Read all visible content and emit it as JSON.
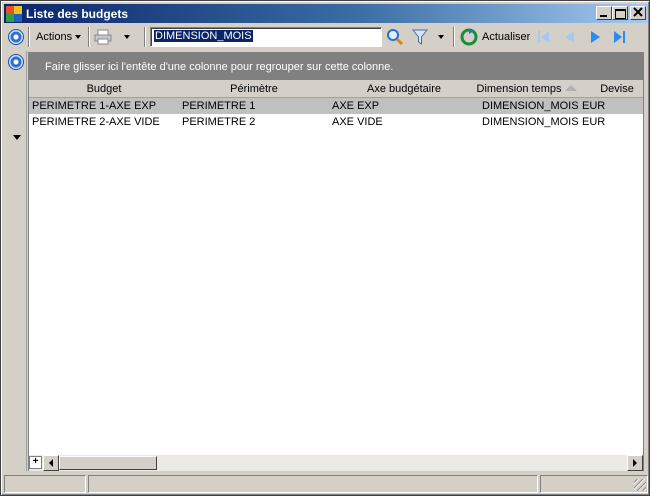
{
  "window": {
    "title": "Liste des budgets"
  },
  "toolbar": {
    "actions_label": "Actions",
    "search_value": "DIMENSION_MOIS",
    "refresh_label": "Actualiser"
  },
  "grid": {
    "group_hint": "Faire glisser ici l'entête d'une colonne pour regrouper sur cette colonne.",
    "columns": [
      "Budget",
      "Périmètre",
      "Axe budgétaire",
      "Dimension temps",
      "Devise"
    ],
    "rows": [
      [
        "PERIMETRE 1-AXE EXP",
        "PERIMETRE 1",
        "AXE EXP",
        "DIMENSION_MOIS",
        "EUR"
      ],
      [
        "PERIMETRE 2-AXE VIDE",
        "PERIMETRE 2",
        "AXE VIDE",
        "DIMENSION_MOIS",
        "EUR"
      ]
    ],
    "add_symbol": "+"
  },
  "colors": {
    "title_bar": "#0a246a",
    "selection": "#c0c0c0",
    "group_area": "#808080",
    "nav_blue": "#2a8bf2"
  }
}
